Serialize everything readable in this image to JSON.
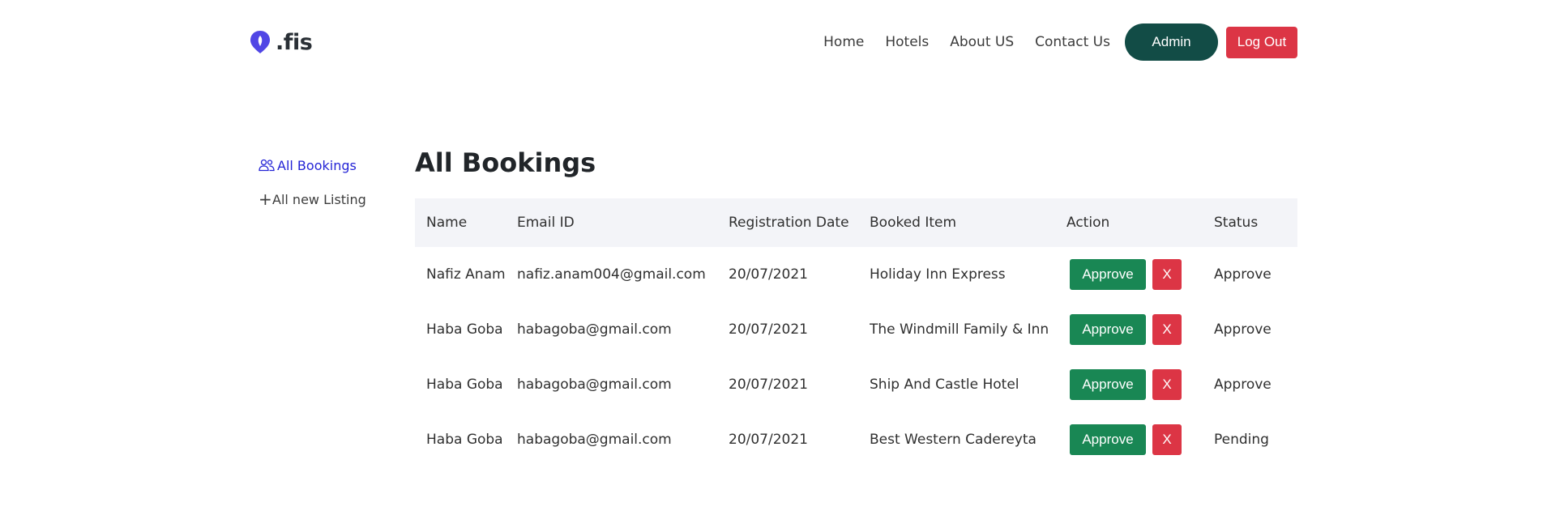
{
  "brand": {
    "name": ".fis",
    "accent": "#4f46e5",
    "icon": "map-pin-icon"
  },
  "nav": {
    "links": [
      "Home",
      "Hotels",
      "About US",
      "Contact Us"
    ],
    "admin_label": "Admin",
    "logout_label": "Log Out"
  },
  "sidebar": {
    "items": [
      {
        "label": "All Bookings",
        "icon": "users-icon"
      },
      {
        "label": "All new Listing",
        "icon": "plus-icon"
      }
    ]
  },
  "main": {
    "title": "All Bookings",
    "columns": [
      "Name",
      "Email ID",
      "Registration Date",
      "Booked Item",
      "Action",
      "Status"
    ],
    "approve_label": "Approve",
    "reject_label": "X",
    "rows": [
      {
        "name": "Nafiz Anam",
        "email": "nafiz.anam004@gmail.com",
        "date": "20/07/2021",
        "item": "Holiday Inn Express",
        "status": "Approve"
      },
      {
        "name": "Haba Goba",
        "email": "habagoba@gmail.com",
        "date": "20/07/2021",
        "item": "The Windmill Family & Inn",
        "status": "Approve"
      },
      {
        "name": "Haba Goba",
        "email": "habagoba@gmail.com",
        "date": "20/07/2021",
        "item": "Ship And Castle Hotel",
        "status": "Approve"
      },
      {
        "name": "Haba Goba",
        "email": "habagoba@gmail.com",
        "date": "20/07/2021",
        "item": "Best Western Cadereyta",
        "status": "Pending"
      }
    ]
  }
}
